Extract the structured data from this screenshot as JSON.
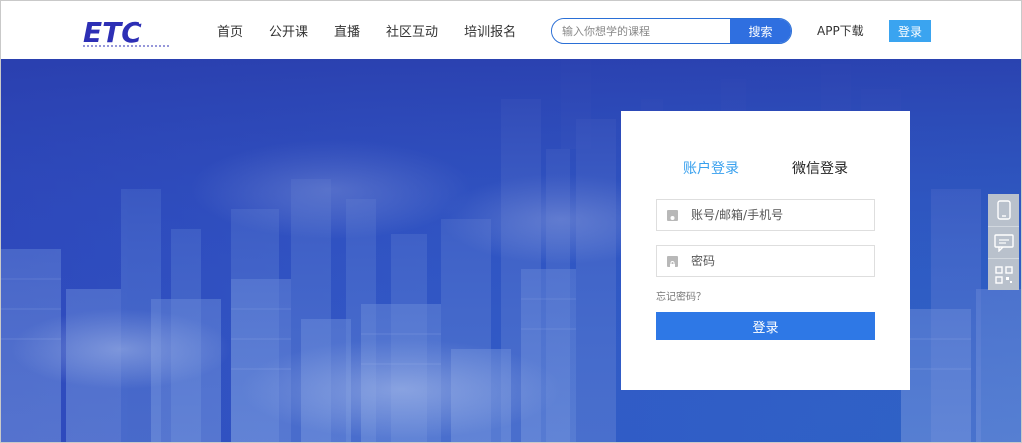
{
  "brand": {
    "logo_text": "ETC"
  },
  "nav": [
    {
      "label": "首页"
    },
    {
      "label": "公开课"
    },
    {
      "label": "直播"
    },
    {
      "label": "社区互动"
    },
    {
      "label": "培训报名"
    }
  ],
  "search": {
    "placeholder": "输入你想学的课程",
    "button": "搜索"
  },
  "header": {
    "app_download": "APP下载",
    "login_button": "登录"
  },
  "login_panel": {
    "tabs": {
      "account": "账户登录",
      "wechat": "微信登录"
    },
    "account_placeholder": "账号/邮箱/手机号",
    "password_placeholder": "密码",
    "forgot": "忘记密码？",
    "submit": "登录"
  },
  "side_tools": [
    "mobile-icon",
    "chat-icon",
    "qrcode-icon"
  ],
  "colors": {
    "accent": "#2e78e6",
    "tab_active": "#38a0ee",
    "hero": "#3155c4"
  }
}
